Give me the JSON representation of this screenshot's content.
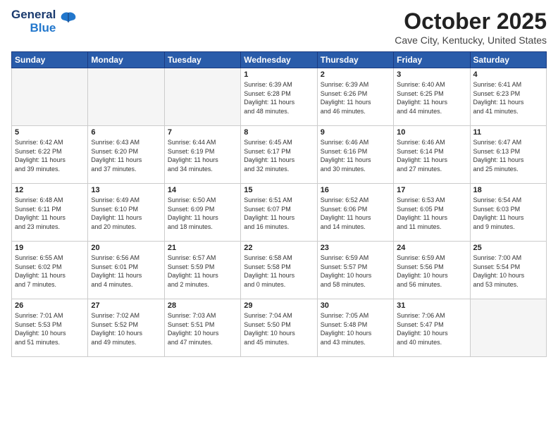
{
  "header": {
    "logo_general": "General",
    "logo_blue": "Blue",
    "month": "October 2025",
    "location": "Cave City, Kentucky, United States"
  },
  "days_of_week": [
    "Sunday",
    "Monday",
    "Tuesday",
    "Wednesday",
    "Thursday",
    "Friday",
    "Saturday"
  ],
  "weeks": [
    [
      {
        "day": "",
        "info": ""
      },
      {
        "day": "",
        "info": ""
      },
      {
        "day": "",
        "info": ""
      },
      {
        "day": "1",
        "info": "Sunrise: 6:39 AM\nSunset: 6:28 PM\nDaylight: 11 hours\nand 48 minutes."
      },
      {
        "day": "2",
        "info": "Sunrise: 6:39 AM\nSunset: 6:26 PM\nDaylight: 11 hours\nand 46 minutes."
      },
      {
        "day": "3",
        "info": "Sunrise: 6:40 AM\nSunset: 6:25 PM\nDaylight: 11 hours\nand 44 minutes."
      },
      {
        "day": "4",
        "info": "Sunrise: 6:41 AM\nSunset: 6:23 PM\nDaylight: 11 hours\nand 41 minutes."
      }
    ],
    [
      {
        "day": "5",
        "info": "Sunrise: 6:42 AM\nSunset: 6:22 PM\nDaylight: 11 hours\nand 39 minutes."
      },
      {
        "day": "6",
        "info": "Sunrise: 6:43 AM\nSunset: 6:20 PM\nDaylight: 11 hours\nand 37 minutes."
      },
      {
        "day": "7",
        "info": "Sunrise: 6:44 AM\nSunset: 6:19 PM\nDaylight: 11 hours\nand 34 minutes."
      },
      {
        "day": "8",
        "info": "Sunrise: 6:45 AM\nSunset: 6:17 PM\nDaylight: 11 hours\nand 32 minutes."
      },
      {
        "day": "9",
        "info": "Sunrise: 6:46 AM\nSunset: 6:16 PM\nDaylight: 11 hours\nand 30 minutes."
      },
      {
        "day": "10",
        "info": "Sunrise: 6:46 AM\nSunset: 6:14 PM\nDaylight: 11 hours\nand 27 minutes."
      },
      {
        "day": "11",
        "info": "Sunrise: 6:47 AM\nSunset: 6:13 PM\nDaylight: 11 hours\nand 25 minutes."
      }
    ],
    [
      {
        "day": "12",
        "info": "Sunrise: 6:48 AM\nSunset: 6:11 PM\nDaylight: 11 hours\nand 23 minutes."
      },
      {
        "day": "13",
        "info": "Sunrise: 6:49 AM\nSunset: 6:10 PM\nDaylight: 11 hours\nand 20 minutes."
      },
      {
        "day": "14",
        "info": "Sunrise: 6:50 AM\nSunset: 6:09 PM\nDaylight: 11 hours\nand 18 minutes."
      },
      {
        "day": "15",
        "info": "Sunrise: 6:51 AM\nSunset: 6:07 PM\nDaylight: 11 hours\nand 16 minutes."
      },
      {
        "day": "16",
        "info": "Sunrise: 6:52 AM\nSunset: 6:06 PM\nDaylight: 11 hours\nand 14 minutes."
      },
      {
        "day": "17",
        "info": "Sunrise: 6:53 AM\nSunset: 6:05 PM\nDaylight: 11 hours\nand 11 minutes."
      },
      {
        "day": "18",
        "info": "Sunrise: 6:54 AM\nSunset: 6:03 PM\nDaylight: 11 hours\nand 9 minutes."
      }
    ],
    [
      {
        "day": "19",
        "info": "Sunrise: 6:55 AM\nSunset: 6:02 PM\nDaylight: 11 hours\nand 7 minutes."
      },
      {
        "day": "20",
        "info": "Sunrise: 6:56 AM\nSunset: 6:01 PM\nDaylight: 11 hours\nand 4 minutes."
      },
      {
        "day": "21",
        "info": "Sunrise: 6:57 AM\nSunset: 5:59 PM\nDaylight: 11 hours\nand 2 minutes."
      },
      {
        "day": "22",
        "info": "Sunrise: 6:58 AM\nSunset: 5:58 PM\nDaylight: 11 hours\nand 0 minutes."
      },
      {
        "day": "23",
        "info": "Sunrise: 6:59 AM\nSunset: 5:57 PM\nDaylight: 10 hours\nand 58 minutes."
      },
      {
        "day": "24",
        "info": "Sunrise: 6:59 AM\nSunset: 5:56 PM\nDaylight: 10 hours\nand 56 minutes."
      },
      {
        "day": "25",
        "info": "Sunrise: 7:00 AM\nSunset: 5:54 PM\nDaylight: 10 hours\nand 53 minutes."
      }
    ],
    [
      {
        "day": "26",
        "info": "Sunrise: 7:01 AM\nSunset: 5:53 PM\nDaylight: 10 hours\nand 51 minutes."
      },
      {
        "day": "27",
        "info": "Sunrise: 7:02 AM\nSunset: 5:52 PM\nDaylight: 10 hours\nand 49 minutes."
      },
      {
        "day": "28",
        "info": "Sunrise: 7:03 AM\nSunset: 5:51 PM\nDaylight: 10 hours\nand 47 minutes."
      },
      {
        "day": "29",
        "info": "Sunrise: 7:04 AM\nSunset: 5:50 PM\nDaylight: 10 hours\nand 45 minutes."
      },
      {
        "day": "30",
        "info": "Sunrise: 7:05 AM\nSunset: 5:48 PM\nDaylight: 10 hours\nand 43 minutes."
      },
      {
        "day": "31",
        "info": "Sunrise: 7:06 AM\nSunset: 5:47 PM\nDaylight: 10 hours\nand 40 minutes."
      },
      {
        "day": "",
        "info": ""
      }
    ]
  ]
}
